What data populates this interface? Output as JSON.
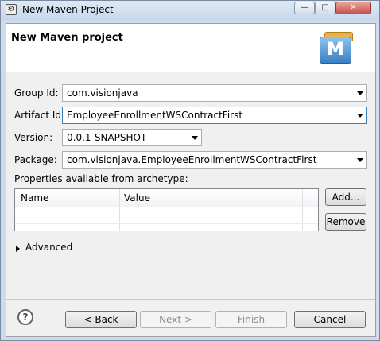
{
  "window": {
    "title": "New Maven Project",
    "minimize_glyph": "—",
    "maximize_glyph": "□",
    "close_glyph": "✕"
  },
  "banner": {
    "title": "New Maven project",
    "icon": "maven-icon",
    "icon_letter": "M"
  },
  "form": {
    "group_id": {
      "label": "Group Id:",
      "value": "com.visionjava"
    },
    "artifact_id": {
      "label": "Artifact Id:",
      "value": "EmployeeEnrollmentWSContractFirst"
    },
    "version": {
      "label": "Version:",
      "value": "0.0.1-SNAPSHOT"
    },
    "package": {
      "label": "Package:",
      "value": "com.visionjava.EmployeeEnrollmentWSContractFirst"
    }
  },
  "properties": {
    "label": "Properties available from archetype:",
    "columns": [
      "Name",
      "Value"
    ],
    "add_label": "Add...",
    "remove_label": "Remove"
  },
  "advanced": {
    "label": "Advanced"
  },
  "footer": {
    "help_glyph": "?",
    "back_label": "< Back",
    "next_label": "Next >",
    "finish_label": "Finish",
    "cancel_label": "Cancel"
  }
}
